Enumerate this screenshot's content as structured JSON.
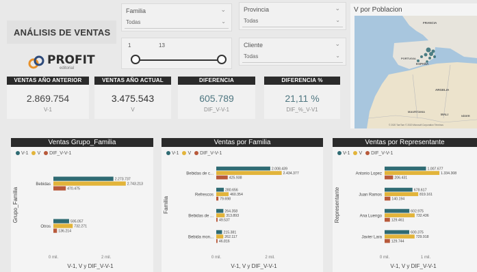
{
  "title": "ANÁLISIS DE VENTAS",
  "logo": {
    "brand": "PROFIT",
    "sub": "editorial"
  },
  "colors": {
    "teal": "#2f6b73",
    "gold": "#e2b43a",
    "rust": "#b8593a",
    "dark": "#2b2b2b"
  },
  "slicers": {
    "familia": {
      "label": "Familia",
      "value": "Todas"
    },
    "provincia": {
      "label": "Provincia",
      "value": "Todas"
    },
    "cliente": {
      "label": "Cliente",
      "value": "Todas"
    },
    "range": {
      "min": "1",
      "max": "13",
      "low_fraction": 0.0,
      "high_fraction": 1.0
    }
  },
  "map": {
    "title": "V por Poblacion",
    "labels": [
      "FRANCIA",
      "ESPAÑA",
      "PORTUGAL",
      "ARGELIA",
      "MAURITANIA",
      "MALI",
      "NÍGER"
    ],
    "footer": "© 2020 TomTom © 2020 Microsoft Corporation  Términos"
  },
  "kpis": [
    {
      "head": "VENTAS AÑO ANTERIOR",
      "value": "2.869.754",
      "sub": "V-1",
      "color": "#444444"
    },
    {
      "head": "VENTAS AÑO ACTUAL",
      "value": "3.475.543",
      "sub": "V",
      "color": "#333333"
    },
    {
      "head": "DIFERENCIA",
      "value": "605.789",
      "sub": "DIF_V-V-1",
      "color": "#4e7680"
    },
    {
      "head": "DIFERENCIA %",
      "value": "21,11 %",
      "sub": "DIF_%_V-V1",
      "color": "#4e7680"
    }
  ],
  "legend": [
    "V-1",
    "V",
    "DIF_V-V-1"
  ],
  "chart_data": [
    {
      "type": "bar",
      "title": "Ventas Grupo_Familia",
      "ylabel": "Grupo_Familia",
      "xlabel": "V-1, V y DIF_V-V-1",
      "xticks": [
        "0 mil.",
        "2 mil."
      ],
      "xlim": [
        0,
        2800000
      ],
      "categories": [
        "Bebidas",
        "Otros"
      ],
      "series": [
        {
          "name": "V-1",
          "values": [
            2273737,
            595057
          ]
        },
        {
          "name": "V",
          "values": [
            2743213,
            732271
          ]
        },
        {
          "name": "DIF_V-V-1",
          "values": [
            470475,
            136214
          ]
        }
      ],
      "labels": [
        [
          "2.273.737",
          "2.743.213",
          "470.475"
        ],
        [
          "595.057",
          "732.271",
          "136.214"
        ]
      ]
    },
    {
      "type": "bar",
      "title": "Ventas por Familia",
      "ylabel": "Familia",
      "xlabel": "V-1, V y DIF_V-V-1",
      "xticks": [
        "0 mil.",
        "2 mil."
      ],
      "xlim": [
        0,
        2800000
      ],
      "categories": [
        "Bebidas de c...",
        "Refrescos",
        "Bebidas de ...",
        "Bebida mon..."
      ],
      "series": [
        {
          "name": "V-1",
          "values": [
            2008439,
            280656,
            264358,
            215381
          ]
        },
        {
          "name": "V",
          "values": [
            2434377,
            460354,
            313893,
            262117
          ]
        },
        {
          "name": "DIF_V-V-1",
          "values": [
            425938,
            79698,
            49537,
            46816
          ]
        }
      ],
      "labels": [
        [
          "2.008.439",
          "2.434.377",
          "425.938"
        ],
        [
          "280.656",
          "460.354",
          "79.698"
        ],
        [
          "264.358",
          "313.893",
          "49.537"
        ],
        [
          "215.381",
          "262.117",
          "46.816"
        ]
      ]
    },
    {
      "type": "bar",
      "title": "Ventas por Representante",
      "ylabel": "Representante",
      "xlabel": "V-1, V y DIF_V-V-1",
      "xticks": [
        "0 mil.",
        "1 mil."
      ],
      "xlim": [
        0,
        1400000
      ],
      "categories": [
        "Antonio Lopez",
        "Juan Ramos",
        "Ana Luengo",
        "Javier Lara"
      ],
      "series": [
        {
          "name": "V-1",
          "values": [
            1007677,
            678617,
            602975,
            600375
          ]
        },
        {
          "name": "V",
          "values": [
            1334308,
            819161,
            732436,
            729918
          ]
        },
        {
          "name": "DIF_V-V-1",
          "values": [
            206431,
            140194,
            129461,
            129744
          ]
        }
      ],
      "labels": [
        [
          "1.007.677",
          "1.334.308",
          "206.431"
        ],
        [
          "678.617",
          "819.161",
          "140.194"
        ],
        [
          "602.975",
          "732.436",
          "129.461"
        ],
        [
          "600.375",
          "729.918",
          "129.744"
        ]
      ]
    }
  ]
}
